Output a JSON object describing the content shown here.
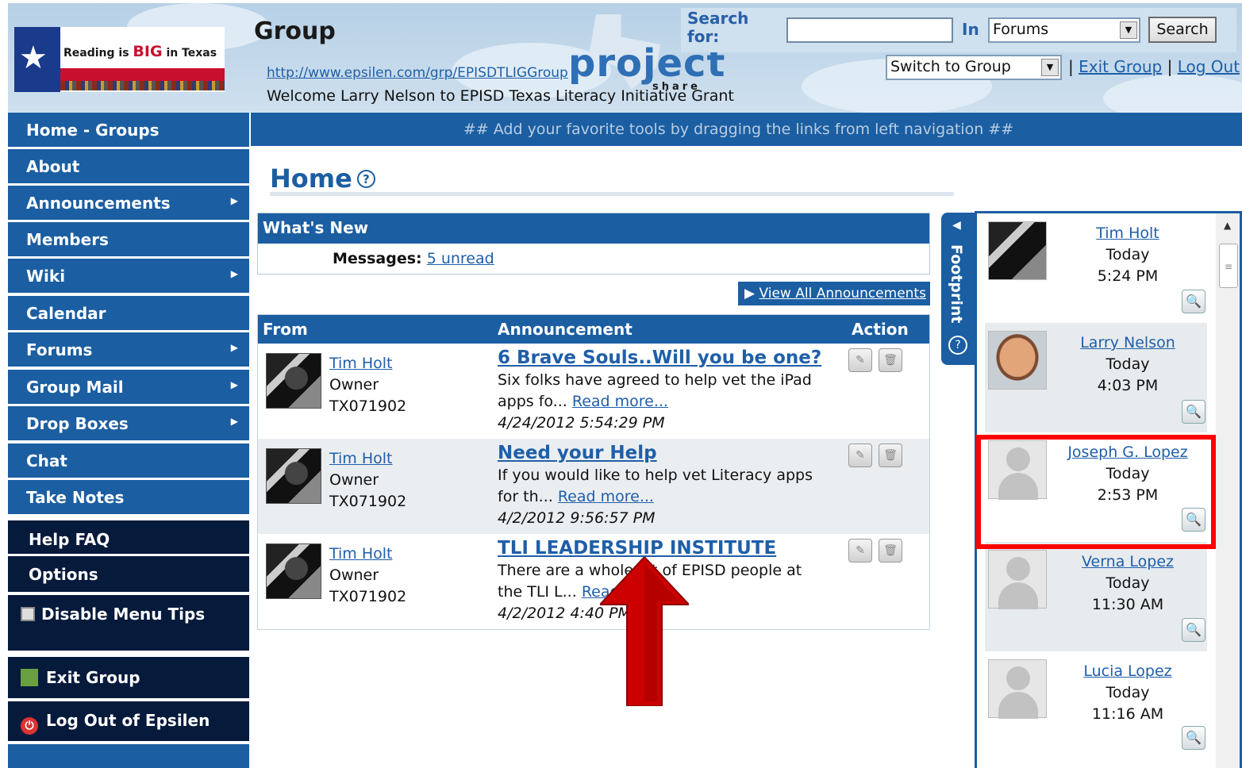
{
  "header": {
    "logo_prefix": "Reading is ",
    "logo_big": "BIG",
    "logo_suffix": " in Texas",
    "group_title": "Group",
    "group_url": "http://www.epsilen.com/grp/EPISDTLIGGroup",
    "welcome": "Welcome Larry Nelson to EPISD Texas Literacy Initiative Grant",
    "project_word": "project",
    "project_share": "share",
    "search_label": "Search for:",
    "search_value": "",
    "in_label": "In",
    "in_selected": "Forums",
    "search_button": "Search",
    "switch_selected": "Switch to Group",
    "exit_group": "Exit Group",
    "log_out": "Log Out",
    "separator": "|"
  },
  "sidebar": {
    "items": [
      {
        "label": "Home - Groups",
        "submenu": false
      },
      {
        "label": "About",
        "submenu": false
      },
      {
        "label": "Announcements",
        "submenu": true
      },
      {
        "label": "Members",
        "submenu": false
      },
      {
        "label": "Wiki",
        "submenu": true
      },
      {
        "label": "Calendar",
        "submenu": false
      },
      {
        "label": "Forums",
        "submenu": true
      },
      {
        "label": "Group Mail",
        "submenu": true
      },
      {
        "label": "Drop Boxes",
        "submenu": true
      },
      {
        "label": "Chat",
        "submenu": false
      },
      {
        "label": "Take Notes",
        "submenu": false
      }
    ],
    "help_faq": "Help FAQ",
    "options": "Options",
    "disable_tips": "Disable Menu Tips",
    "exit_group": "Exit Group",
    "logout_epsilen": "Log Out of Epsilen"
  },
  "main": {
    "tools_bar": "## Add your favorite tools by dragging the links from left navigation ##",
    "page_title": "Home",
    "help_icon": "?",
    "whats_new_title": "What's New",
    "messages_label": "Messages:",
    "messages_link": "5 unread",
    "view_all": "View All Announcements",
    "columns": {
      "from": "From",
      "announcement": "Announcement",
      "action": "Action"
    },
    "announcements": [
      {
        "from_name": "Tim Holt",
        "from_role": "Owner",
        "from_id": "TX071902",
        "title": "6 Brave Souls..Will you be one?",
        "snippet": "Six folks have agreed to help vet the iPad apps fo...",
        "read_more": "Read more...",
        "date": "4/24/2012 5:54:29 PM"
      },
      {
        "from_name": "Tim Holt",
        "from_role": "Owner",
        "from_id": "TX071902",
        "title": "Need your Help",
        "snippet": "If you would like to help vet Literacy apps for th...",
        "read_more": "Read more...",
        "date": "4/2/2012 9:56:57 PM"
      },
      {
        "from_name": "Tim Holt",
        "from_role": "Owner",
        "from_id": "TX071902",
        "title": "TLI LEADERSHIP INSTITUTE",
        "snippet": "There are a whole lot of EPISD people at the TLI L...",
        "read_more": "Read more...",
        "date": "4/2/2012 4:40 PM"
      }
    ]
  },
  "footprint": {
    "tab_label": "Footprint",
    "entries": [
      {
        "name": "Tim Holt",
        "day": "Today",
        "time": "5:24 PM",
        "photo": "tim"
      },
      {
        "name": "Larry Nelson",
        "day": "Today",
        "time": "4:03 PM",
        "photo": "larry"
      },
      {
        "name": "Joseph G. Lopez",
        "day": "Today",
        "time": "2:53 PM",
        "photo": "generic"
      },
      {
        "name": "Verna Lopez",
        "day": "Today",
        "time": "11:30 AM",
        "photo": "generic"
      },
      {
        "name": "Lucia Lopez",
        "day": "Today",
        "time": "11:16 AM",
        "photo": "generic"
      }
    ]
  },
  "colors": {
    "nav_blue": "#1b5ea2",
    "nav_dark": "#061a3c",
    "highlight": "#ff0000",
    "arrow": "#cc0000"
  }
}
